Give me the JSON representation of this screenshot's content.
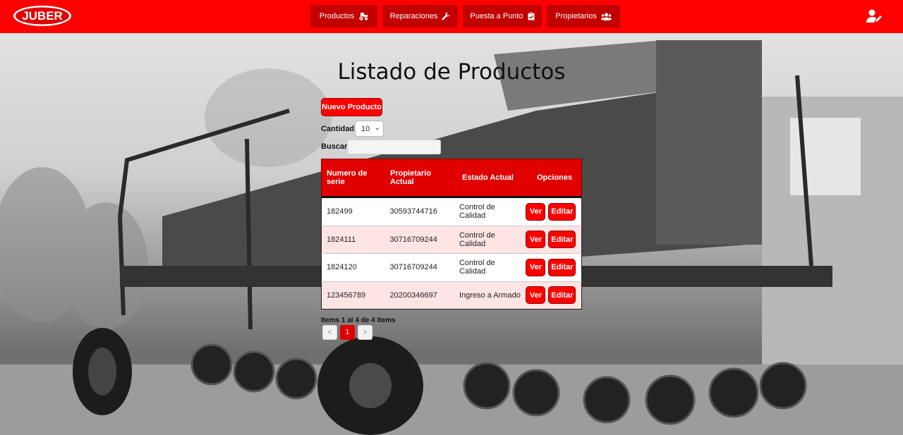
{
  "navbar": {
    "logo_text": "JUBER",
    "items": [
      {
        "label": "Productos",
        "icon": "tractor-icon"
      },
      {
        "label": "Reparaciones",
        "icon": "wrench-icon"
      },
      {
        "label": "Puesta a Punto",
        "icon": "clipboard-check-icon"
      },
      {
        "label": "Propietarios",
        "icon": "users-icon"
      }
    ],
    "user_icon": "user-edit-icon",
    "color": "#ff0000",
    "button_color": "#c20000"
  },
  "page": {
    "title": "Listado de Productos",
    "new_button": "Nuevo Producto",
    "cantidad_label": "Cantidad:",
    "cantidad_value": "10",
    "buscar_label": "Buscar :",
    "search_value": ""
  },
  "table": {
    "headers": [
      "Numero de serie",
      "Propietario Actual",
      "Estado Actual",
      "Opciones"
    ],
    "rows": [
      {
        "serie": "182499",
        "propietario": "30593744716",
        "estado": "Control de Calidad"
      },
      {
        "serie": "1824111",
        "propietario": "30716709244",
        "estado": "Control de Calidad"
      },
      {
        "serie": "1824120",
        "propietario": "30716709244",
        "estado": "Control de Calidad"
      },
      {
        "serie": "123456789",
        "propietario": "20200346697",
        "estado": "Ingreso a Armado"
      }
    ],
    "ver_label": "Ver",
    "editar_label": "Editar"
  },
  "pagination": {
    "info": "Items 1 al 4 de 4 Items",
    "prev": "<",
    "current": "1",
    "next": ">"
  }
}
